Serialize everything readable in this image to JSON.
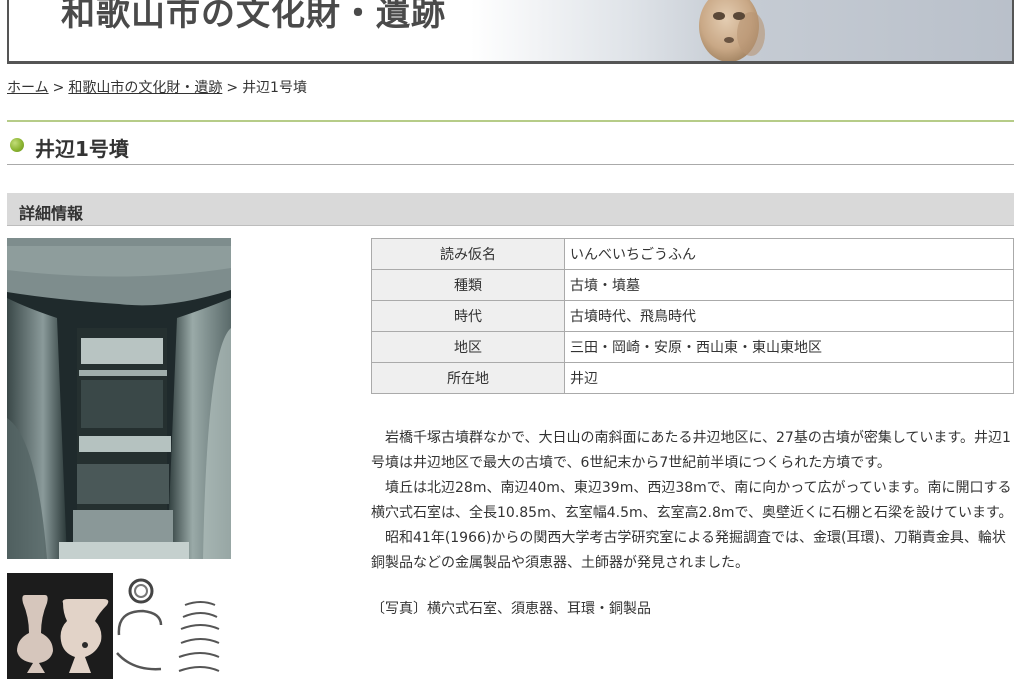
{
  "banner": {
    "title": "和歌山市の文化財・遺跡"
  },
  "breadcrumb": {
    "home": "ホーム",
    "separator": ">",
    "parent": "和歌山市の文化財・遺跡",
    "current": "井辺1号墳"
  },
  "page": {
    "title": "井辺1号墳"
  },
  "section": {
    "title": "詳細情報"
  },
  "info_table": [
    {
      "label": "読み仮名",
      "value": "いんべいちごうふん"
    },
    {
      "label": "種類",
      "value": "古墳・墳墓"
    },
    {
      "label": "時代",
      "value": "古墳時代、飛鳥時代"
    },
    {
      "label": "地区",
      "value": "三田・岡崎・安原・西山東・東山東地区"
    },
    {
      "label": "所在地",
      "value": "井辺"
    }
  ],
  "description": [
    "岩橋千塚古墳群なかで、大日山の南斜面にあたる井辺地区に、27基の古墳が密集しています。井辺1号墳は井辺地区で最大の古墳で、6世紀末から7世紀前半頃につくられた方墳です。",
    "墳丘は北辺28m、南辺40m、東辺39m、西辺38mで、南に向かって広がっています。南に開口する横穴式石室は、全長10.85m、玄室幅4.5m、玄室高2.8mで、奥壁近くに石棚と石梁を設けています。",
    "昭和41年(1966)からの関西大学考古学研究室による発掘調査では、金環(耳環)、刀鞘責金具、輪状銅製品などの金属製品や須恵器、土師器が発見されました。"
  ],
  "caption": "〔写真〕横穴式石室、須恵器、耳環・銅製品",
  "colors": {
    "accent_green": "#8cb532",
    "rule_green": "#b6cc88",
    "section_bg": "#d9d9d9",
    "table_key_bg": "#efefef"
  }
}
